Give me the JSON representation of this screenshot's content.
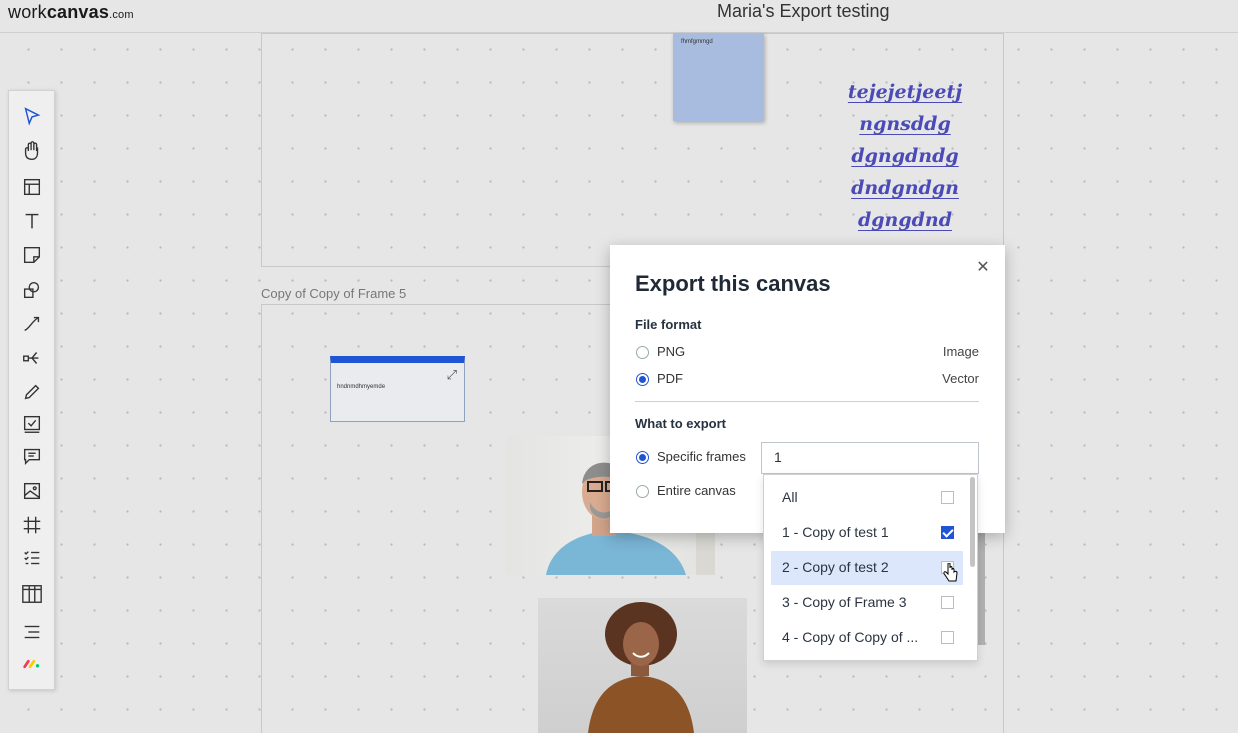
{
  "app": {
    "logo_prefix": "work",
    "logo_bold": "canvas",
    "logo_suffix": ".com",
    "title": "Maria's Export testing"
  },
  "canvas": {
    "frame_label": "Copy of Copy of Frame 5",
    "sticky_text": "fhmfgmmgd",
    "handwriting": [
      "tejejetjeetj",
      "ngnsddg",
      "dgngdndg",
      "dndgndgn",
      "dgngdnd"
    ],
    "mini_frame_text": "hndnmdhmyemde"
  },
  "toolbar": {
    "tools": [
      {
        "icon": "select-arrow-icon"
      },
      {
        "icon": "hand-icon"
      },
      {
        "icon": "template-icon"
      },
      {
        "icon": "text-icon"
      },
      {
        "icon": "sticky-note-icon"
      },
      {
        "icon": "shapes-icon"
      },
      {
        "icon": "connector-line-icon"
      },
      {
        "icon": "mindmap-icon"
      },
      {
        "icon": "pen-icon"
      },
      {
        "icon": "checklist-icon"
      },
      {
        "icon": "comment-icon"
      },
      {
        "icon": "image-icon"
      },
      {
        "icon": "frame-icon"
      },
      {
        "icon": "list-icon"
      },
      {
        "icon": "table-icon"
      },
      {
        "icon": "outline-icon"
      },
      {
        "icon": "monday-logo-icon"
      }
    ]
  },
  "export_dialog": {
    "title": "Export this canvas",
    "file_format_label": "File format",
    "formats": [
      {
        "label": "PNG",
        "type": "Image",
        "checked": false
      },
      {
        "label": "PDF",
        "type": "Vector",
        "checked": true
      }
    ],
    "what_to_export_label": "What to export",
    "scope_options": [
      {
        "label": "Specific frames",
        "checked": true
      },
      {
        "label": "Entire canvas",
        "checked": false
      }
    ],
    "frames_input_value": "1",
    "frames_dropdown": [
      {
        "label": "All",
        "checked": false,
        "hover": false
      },
      {
        "label": "1 - Copy of test 1",
        "checked": true,
        "hover": false
      },
      {
        "label": "2 - Copy of test 2",
        "checked": false,
        "hover": true
      },
      {
        "label": "3 - Copy of Frame 3",
        "checked": false,
        "hover": false
      },
      {
        "label": "4 - Copy of Copy of ...",
        "checked": false,
        "hover": false
      }
    ]
  },
  "colors": {
    "accent": "#1f55d4",
    "sticky": "#a8bce0",
    "hover_row": "#dce7fc",
    "handwriting": "#4a4ab8"
  }
}
